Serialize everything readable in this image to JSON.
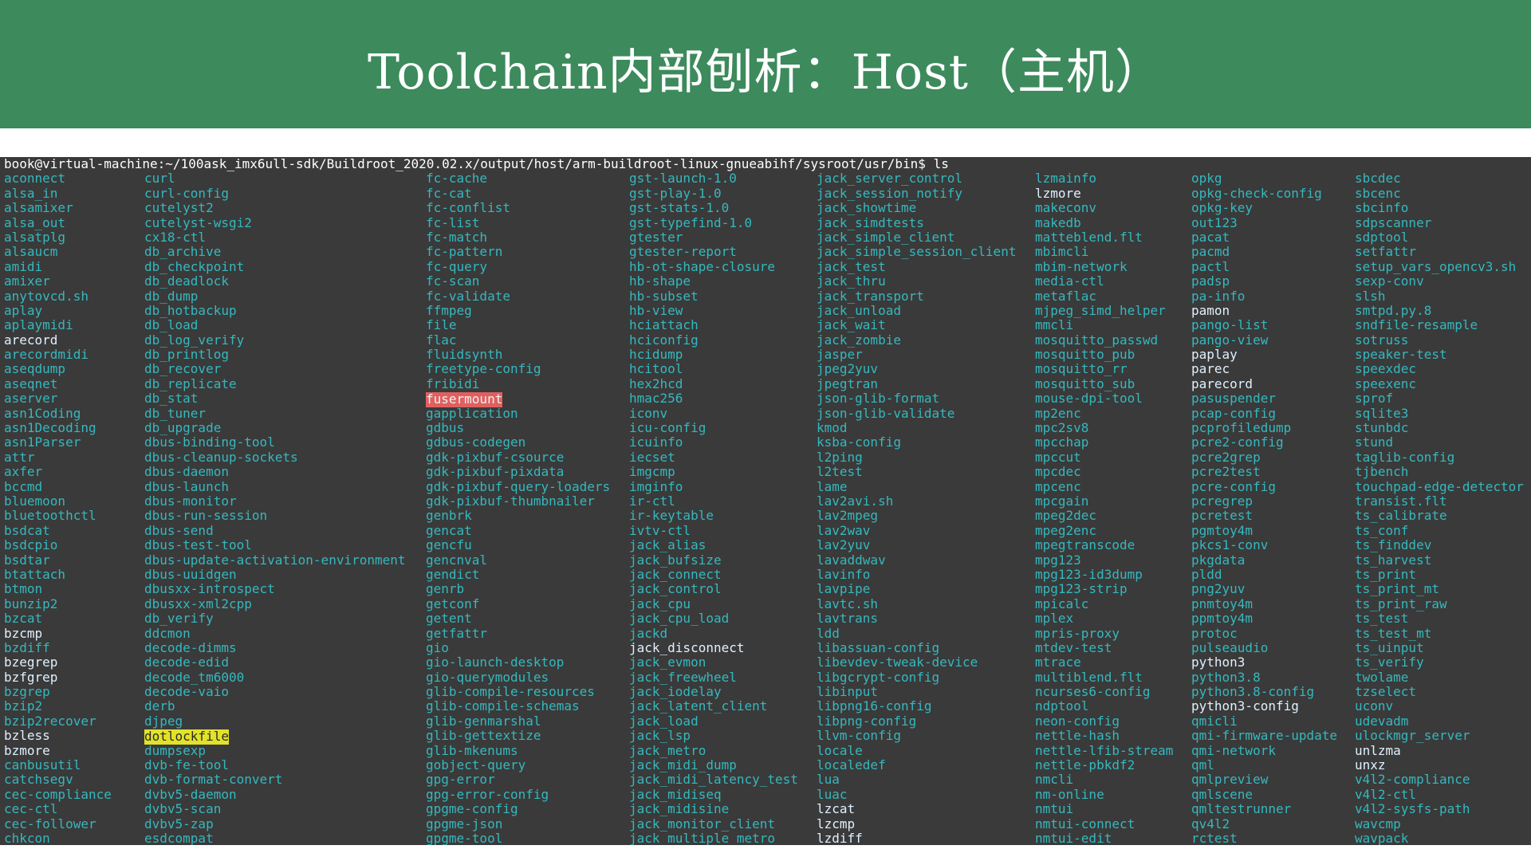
{
  "slide": {
    "title": "Toolchain内部刨析：Host（主机）"
  },
  "terminal": {
    "prompt": "book@virtual-machine:~/100ask_imx6ull-sdk/Buildroot_2020.02.x/output/host/arm-buildroot-linux-gnueabihf/sysroot/usr/bin$ ls",
    "colors": {
      "background": "#3a3a3a",
      "file": "#35b8be",
      "symlink": "#e0f0ff",
      "setuid_bg": "#e06060",
      "setgid_bg": "#e2e22a"
    },
    "columns": [
      [
        "aconnect",
        "alsa_in",
        "alsamixer",
        "alsa_out",
        "alsatplg",
        "alsaucm",
        "amidi",
        "amixer",
        "anytovcd.sh",
        "aplay",
        "aplaymidi",
        "arecord",
        "arecordmidi",
        "aseqdump",
        "aseqnet",
        "aserver",
        "asn1Coding",
        "asn1Decoding",
        "asn1Parser",
        "attr",
        "axfer",
        "bccmd",
        "bluemoon",
        "bluetoothctl",
        "bsdcat",
        "bsdcpio",
        "bsdtar",
        "btattach",
        "btmon",
        "bunzip2",
        "bzcat",
        "bzcmp",
        "bzdiff",
        "bzegrep",
        "bzfgrep",
        "bzgrep",
        "bzip2",
        "bzip2recover",
        "bzless",
        "bzmore",
        "canbusutil",
        "catchsegv",
        "cec-compliance",
        "cec-ctl",
        "cec-follower",
        "chkcon"
      ],
      [
        "curl",
        "curl-config",
        "cutelyst2",
        "cutelyst-wsgi2",
        "cx18-ctl",
        "db_archive",
        "db_checkpoint",
        "db_deadlock",
        "db_dump",
        "db_hotbackup",
        "db_load",
        "db_log_verify",
        "db_printlog",
        "db_recover",
        "db_replicate",
        "db_stat",
        "db_tuner",
        "db_upgrade",
        "dbus-binding-tool",
        "dbus-cleanup-sockets",
        "dbus-daemon",
        "dbus-launch",
        "dbus-monitor",
        "dbus-run-session",
        "dbus-send",
        "dbus-test-tool",
        "dbus-update-activation-environment",
        "dbus-uuidgen",
        "dbusxx-introspect",
        "dbusxx-xml2cpp",
        "db_verify",
        "ddcmon",
        "decode-dimms",
        "decode-edid",
        "decode_tm6000",
        "decode-vaio",
        "derb",
        "djpeg",
        "dotlockfile",
        "dumpsexp",
        "dvb-fe-tool",
        "dvb-format-convert",
        "dvbv5-daemon",
        "dvbv5-scan",
        "dvbv5-zap",
        "esdcompat"
      ],
      [
        "fc-cache",
        "fc-cat",
        "fc-conflist",
        "fc-list",
        "fc-match",
        "fc-pattern",
        "fc-query",
        "fc-scan",
        "fc-validate",
        "ffmpeg",
        "file",
        "flac",
        "fluidsynth",
        "freetype-config",
        "fribidi",
        "fusermount",
        "gapplication",
        "gdbus",
        "gdbus-codegen",
        "gdk-pixbuf-csource",
        "gdk-pixbuf-pixdata",
        "gdk-pixbuf-query-loaders",
        "gdk-pixbuf-thumbnailer",
        "genbrk",
        "gencat",
        "gencfu",
        "gencnval",
        "gendict",
        "genrb",
        "getconf",
        "getent",
        "getfattr",
        "gio",
        "gio-launch-desktop",
        "gio-querymodules",
        "glib-compile-resources",
        "glib-compile-schemas",
        "glib-genmarshal",
        "glib-gettextize",
        "glib-mkenums",
        "gobject-query",
        "gpg-error",
        "gpg-error-config",
        "gpgme-config",
        "gpgme-json",
        "gpgme-tool"
      ],
      [
        "gst-launch-1.0",
        "gst-play-1.0",
        "gst-stats-1.0",
        "gst-typefind-1.0",
        "gtester",
        "gtester-report",
        "hb-ot-shape-closure",
        "hb-shape",
        "hb-subset",
        "hb-view",
        "hciattach",
        "hciconfig",
        "hcidump",
        "hcitool",
        "hex2hcd",
        "hmac256",
        "iconv",
        "icu-config",
        "icuinfo",
        "iecset",
        "imgcmp",
        "imginfo",
        "ir-ctl",
        "ir-keytable",
        "ivtv-ctl",
        "jack_alias",
        "jack_bufsize",
        "jack_connect",
        "jack_control",
        "jack_cpu",
        "jack_cpu_load",
        "jackd",
        "jack_disconnect",
        "jack_evmon",
        "jack_freewheel",
        "jack_iodelay",
        "jack_latent_client",
        "jack_load",
        "jack_lsp",
        "jack_metro",
        "jack_midi_dump",
        "jack_midi_latency_test",
        "jack_midiseq",
        "jack_midisine",
        "jack_monitor_client",
        "jack_multiple_metro"
      ],
      [
        "jack_server_control",
        "jack_session_notify",
        "jack_showtime",
        "jack_simdtests",
        "jack_simple_client",
        "jack_simple_session_client",
        "jack_test",
        "jack_thru",
        "jack_transport",
        "jack_unload",
        "jack_wait",
        "jack_zombie",
        "jasper",
        "jpeg2yuv",
        "jpegtran",
        "json-glib-format",
        "json-glib-validate",
        "kmod",
        "ksba-config",
        "l2ping",
        "l2test",
        "lame",
        "lav2avi.sh",
        "lav2mpeg",
        "lav2wav",
        "lav2yuv",
        "lavaddwav",
        "lavinfo",
        "lavpipe",
        "lavtc.sh",
        "lavtrans",
        "ldd",
        "libassuan-config",
        "libevdev-tweak-device",
        "libgcrypt-config",
        "libinput",
        "libpng16-config",
        "libpng-config",
        "llvm-config",
        "locale",
        "localedef",
        "lua",
        "luac",
        "lzcat",
        "lzcmp",
        "lzdiff"
      ],
      [
        "lzmainfo",
        "lzmore",
        "makeconv",
        "makedb",
        "matteblend.flt",
        "mbimcli",
        "mbim-network",
        "media-ctl",
        "metaflac",
        "mjpeg_simd_helper",
        "mmcli",
        "mosquitto_passwd",
        "mosquitto_pub",
        "mosquitto_rr",
        "mosquitto_sub",
        "mouse-dpi-tool",
        "mp2enc",
        "mpc2sv8",
        "mpcchap",
        "mpccut",
        "mpcdec",
        "mpcenc",
        "mpcgain",
        "mpeg2dec",
        "mpeg2enc",
        "mpegtranscode",
        "mpg123",
        "mpg123-id3dump",
        "mpg123-strip",
        "mpicalc",
        "mplex",
        "mpris-proxy",
        "mtdev-test",
        "mtrace",
        "multiblend.flt",
        "ncurses6-config",
        "ndptool",
        "neon-config",
        "nettle-hash",
        "nettle-lfib-stream",
        "nettle-pbkdf2",
        "nmcli",
        "nm-online",
        "nmtui",
        "nmtui-connect",
        "nmtui-edit"
      ],
      [
        "opkg",
        "opkg-check-config",
        "opkg-key",
        "out123",
        "pacat",
        "pacmd",
        "pactl",
        "padsp",
        "pa-info",
        "pamon",
        "pango-list",
        "pango-view",
        "paplay",
        "parec",
        "parecord",
        "pasuspender",
        "pcap-config",
        "pcprofiledump",
        "pcre2-config",
        "pcre2grep",
        "pcre2test",
        "pcre-config",
        "pcregrep",
        "pcretest",
        "pgmtoy4m",
        "pkcs1-conv",
        "pkgdata",
        "pldd",
        "png2yuv",
        "pnmtoy4m",
        "ppmtoy4m",
        "protoc",
        "pulseaudio",
        "python3",
        "python3.8",
        "python3.8-config",
        "python3-config",
        "qmicli",
        "qmi-firmware-update",
        "qmi-network",
        "qml",
        "qmlpreview",
        "qmlscene",
        "qmltestrunner",
        "qv4l2",
        "rctest"
      ],
      [
        "sbcdec",
        "sbcenc",
        "sbcinfo",
        "sdpscanner",
        "sdptool",
        "setfattr",
        "setup_vars_opencv3.sh",
        "sexp-conv",
        "slsh",
        "smtpd.py.8",
        "sndfile-resample",
        "sotruss",
        "speaker-test",
        "speexdec",
        "speexenc",
        "sprof",
        "sqlite3",
        "stunbdc",
        "stund",
        "taglib-config",
        "tjbench",
        "touchpad-edge-detector",
        "transist.flt",
        "ts_calibrate",
        "ts_conf",
        "ts_finddev",
        "ts_harvest",
        "ts_print",
        "ts_print_mt",
        "ts_print_raw",
        "ts_test",
        "ts_test_mt",
        "ts_uinput",
        "ts_verify",
        "twolame",
        "tzselect",
        "uconv",
        "udevadm",
        "ulockmgr_server",
        "unlzma",
        "unxz",
        "v4l2-compliance",
        "v4l2-ctl",
        "v4l2-sysfs-path",
        "wavcmp",
        "wavpack"
      ]
    ],
    "symlinks": [
      "arecord",
      "bzcmp",
      "bzegrep",
      "bzfgrep",
      "bzless",
      "bzmore",
      "jack_disconnect",
      "lzmore",
      "lzcat",
      "lzcmp",
      "lzdiff",
      "pamon",
      "paplay",
      "parec",
      "parecord",
      "python3",
      "python3-config",
      "unlzma",
      "unxz"
    ],
    "highlight_red": [
      "fusermount"
    ],
    "highlight_yellow": [
      "dotlockfile"
    ]
  }
}
